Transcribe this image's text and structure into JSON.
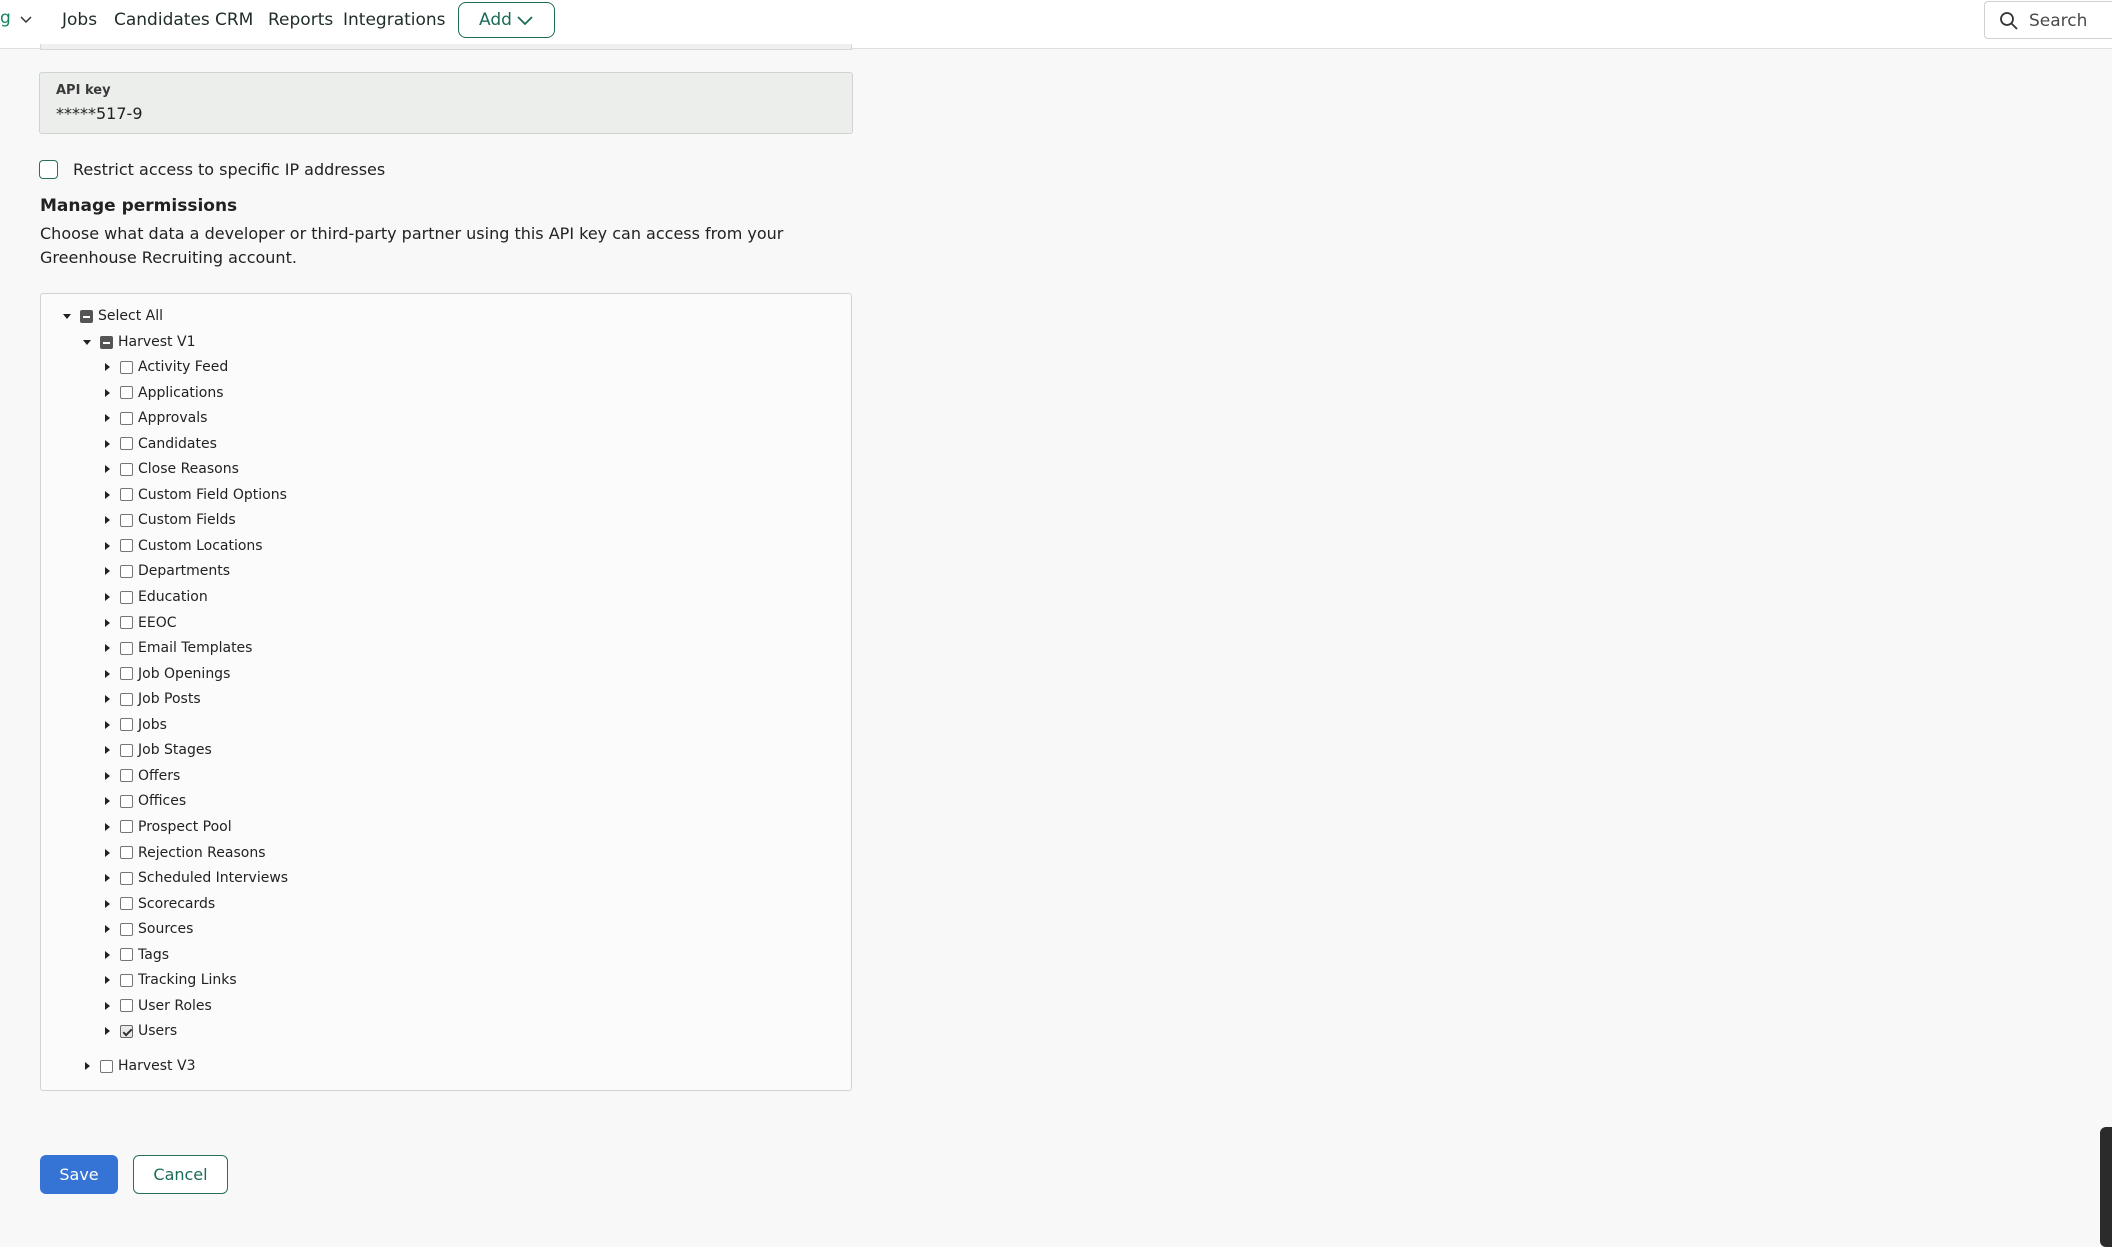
{
  "nav": {
    "brand_fragment": "g",
    "items": [
      "Jobs",
      "Candidates",
      "CRM",
      "Reports",
      "Integrations"
    ],
    "add_label": "Add",
    "search_label": "Search"
  },
  "api_key": {
    "label": "API key",
    "value": "*****517-9"
  },
  "restrict": {
    "label": "Restrict access to specific IP addresses",
    "checked": false
  },
  "permissions": {
    "title": "Manage permissions",
    "description": "Choose what data a developer or third-party partner using this API key can access from your Greenhouse Recruiting account.",
    "select_all": "Select All",
    "harvest_v1": "Harvest V1",
    "harvest_v1_items": [
      {
        "label": "Activity Feed",
        "checked": false
      },
      {
        "label": "Applications",
        "checked": false
      },
      {
        "label": "Approvals",
        "checked": false
      },
      {
        "label": "Candidates",
        "checked": false
      },
      {
        "label": "Close Reasons",
        "checked": false
      },
      {
        "label": "Custom Field Options",
        "checked": false
      },
      {
        "label": "Custom Fields",
        "checked": false
      },
      {
        "label": "Custom Locations",
        "checked": false
      },
      {
        "label": "Departments",
        "checked": false
      },
      {
        "label": "Education",
        "checked": false
      },
      {
        "label": "EEOC",
        "checked": false
      },
      {
        "label": "Email Templates",
        "checked": false
      },
      {
        "label": "Job Openings",
        "checked": false
      },
      {
        "label": "Job Posts",
        "checked": false
      },
      {
        "label": "Jobs",
        "checked": false
      },
      {
        "label": "Job Stages",
        "checked": false
      },
      {
        "label": "Offers",
        "checked": false
      },
      {
        "label": "Offices",
        "checked": false
      },
      {
        "label": "Prospect Pool",
        "checked": false
      },
      {
        "label": "Rejection Reasons",
        "checked": false
      },
      {
        "label": "Scheduled Interviews",
        "checked": false
      },
      {
        "label": "Scorecards",
        "checked": false
      },
      {
        "label": "Sources",
        "checked": false
      },
      {
        "label": "Tags",
        "checked": false
      },
      {
        "label": "Tracking Links",
        "checked": false
      },
      {
        "label": "User Roles",
        "checked": false
      },
      {
        "label": "Users",
        "checked": true
      }
    ],
    "harvest_v3": "Harvest V3"
  },
  "actions": {
    "save_label": "Save",
    "cancel_label": "Cancel"
  }
}
